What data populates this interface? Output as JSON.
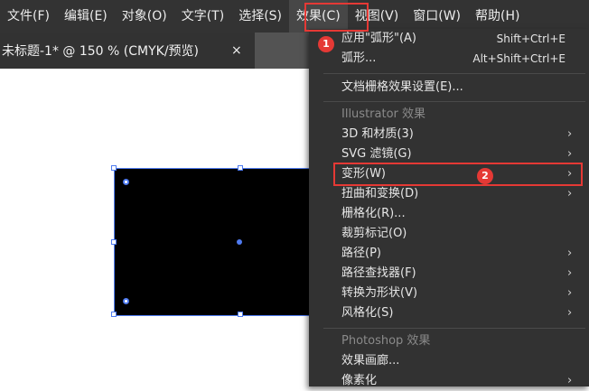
{
  "menubar": {
    "items": [
      "文件(F)",
      "编辑(E)",
      "对象(O)",
      "文字(T)",
      "选择(S)",
      "效果(C)",
      "视图(V)",
      "窗口(W)",
      "帮助(H)"
    ]
  },
  "document_tab": {
    "title": "未标题-1* @ 150 % (CMYK/预览)",
    "close": "×"
  },
  "effect_menu": {
    "items": [
      {
        "label": "应用\"弧形\"(A)",
        "shortcut": "Shift+Ctrl+E"
      },
      {
        "label": "弧形...",
        "shortcut": "Alt+Shift+Ctrl+E"
      },
      {
        "label": "文档栅格效果设置(E)..."
      },
      {
        "label": "Illustrator 效果"
      },
      {
        "label": "3D 和材质(3)"
      },
      {
        "label": "SVG 滤镜(G)"
      },
      {
        "label": "变形(W)"
      },
      {
        "label": "扭曲和变换(D)"
      },
      {
        "label": "栅格化(R)..."
      },
      {
        "label": "裁剪标记(O)"
      },
      {
        "label": "路径(P)"
      },
      {
        "label": "路径查找器(F)"
      },
      {
        "label": "转换为形状(V)"
      },
      {
        "label": "风格化(S)"
      },
      {
        "label": "Photoshop 效果"
      },
      {
        "label": "效果画廊..."
      },
      {
        "label": "像素化"
      }
    ],
    "submenu_arrow": "›"
  },
  "annotations": {
    "step1": "1",
    "step2": "2"
  },
  "colors": {
    "highlight": "#e53935",
    "selection": "#4f7bf0",
    "menu_bg": "#323232"
  }
}
